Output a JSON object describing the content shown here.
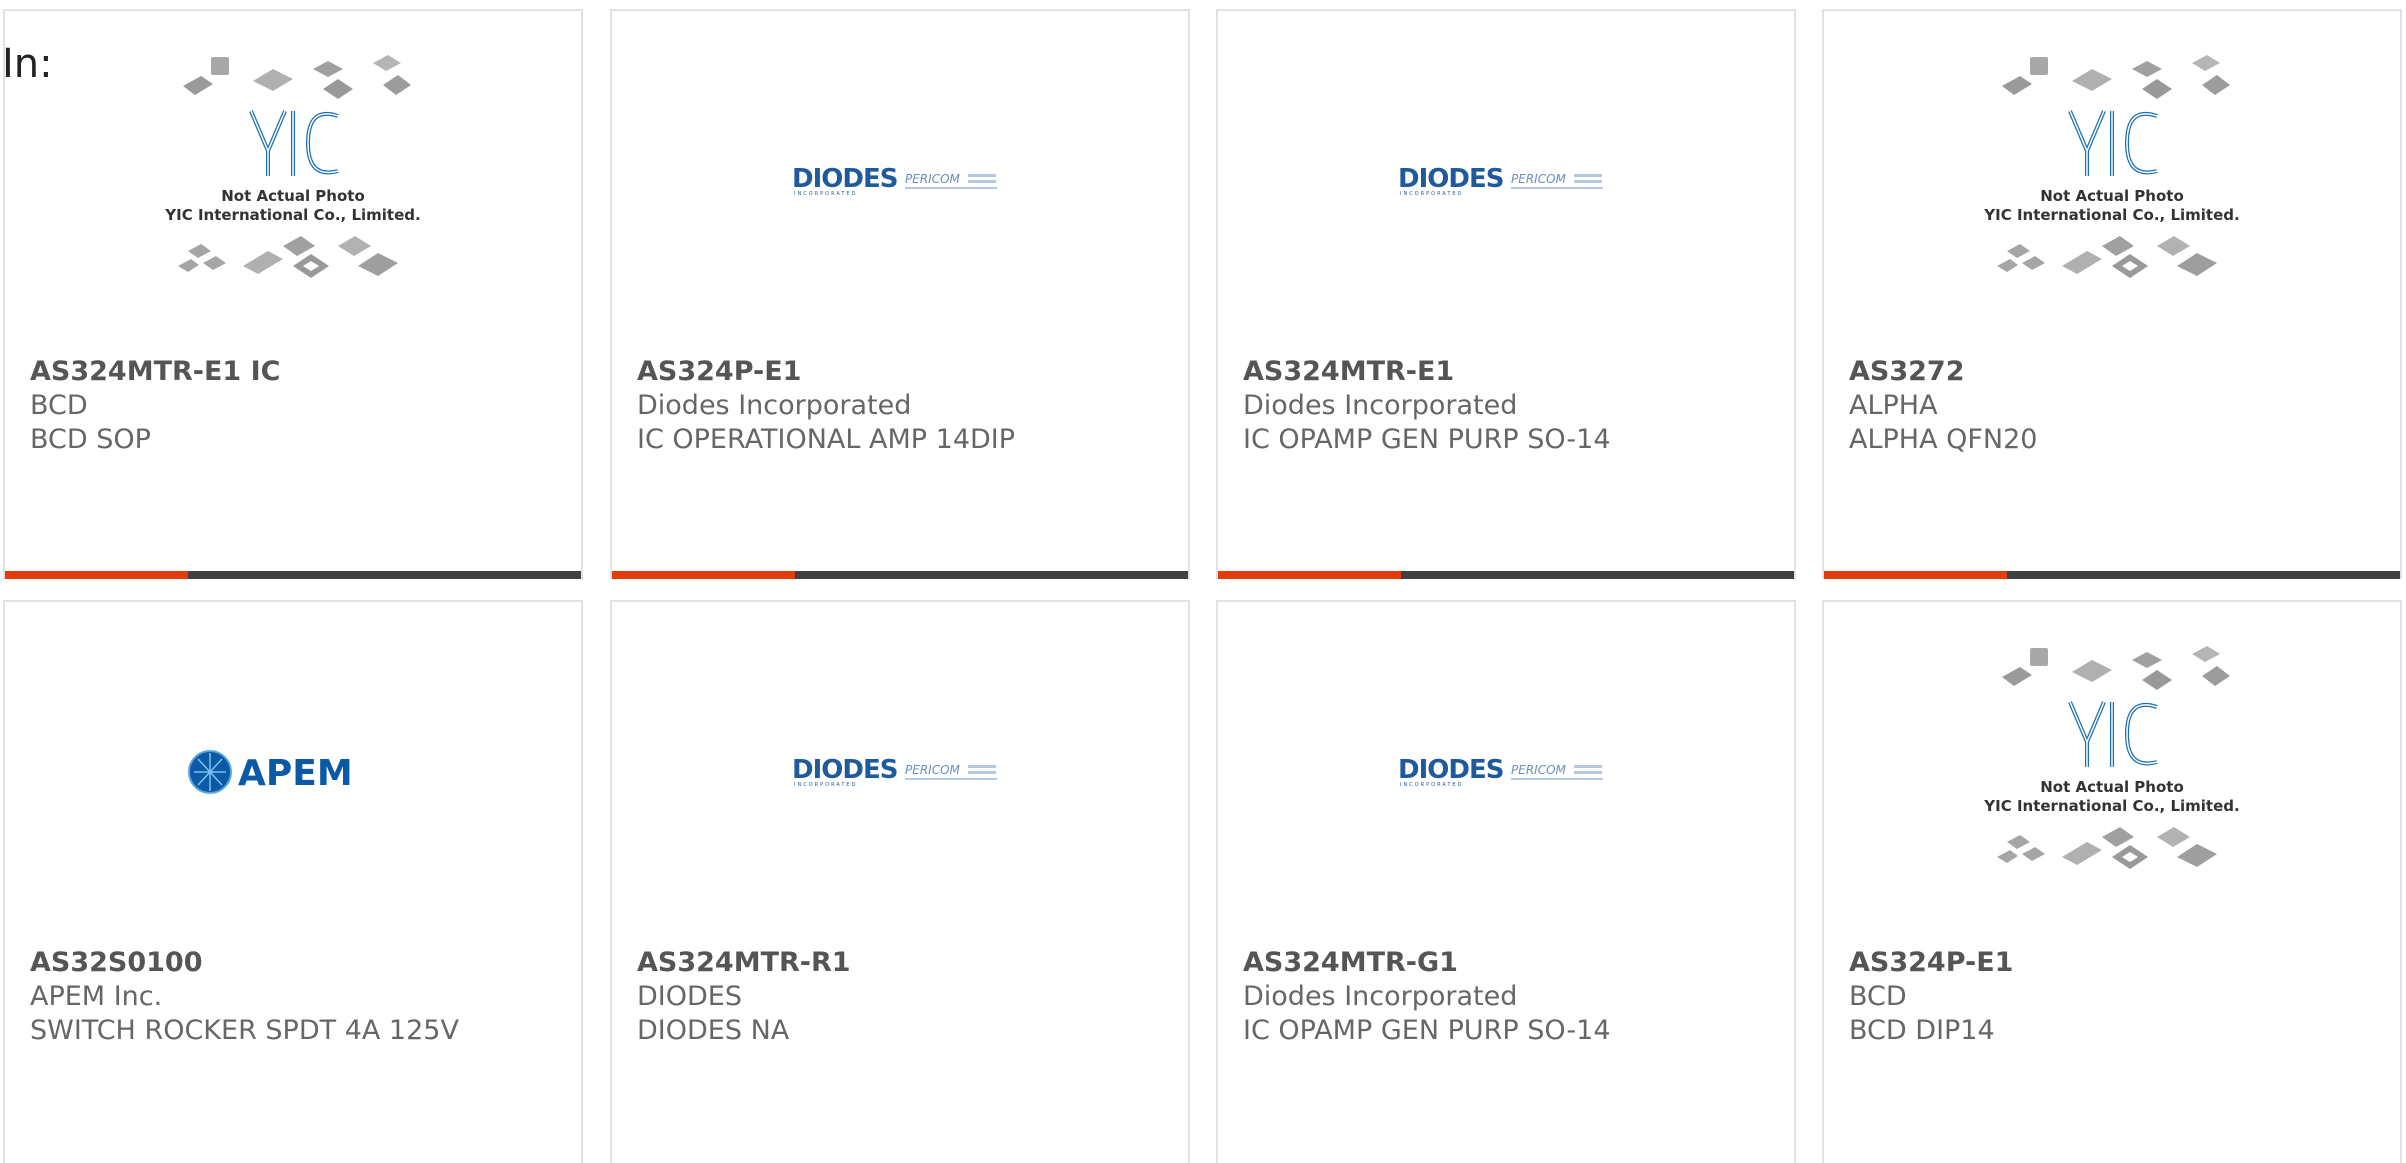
{
  "header": {
    "in_label": "In:"
  },
  "logos": {
    "yic_line1": "Not Actual Photo",
    "yic_line2": "YIC International Co., Limited.",
    "yic_mark": "YIC",
    "diodes_mark": "DIODES",
    "diodes_sub": "INCORPORATED",
    "pericom_mark": "PERICOM",
    "apem_mark": "APEM"
  },
  "cards": [
    {
      "part": "AS324MTR-E1 IC",
      "manufacturer": "BCD",
      "description": "BCD SOP",
      "image": "yic-placeholder"
    },
    {
      "part": "AS324P-E1",
      "manufacturer": "Diodes Incorporated",
      "description": "IC OPERATIONAL AMP 14DIP",
      "image": "diodes-logo"
    },
    {
      "part": "AS324MTR-E1",
      "manufacturer": "Diodes Incorporated",
      "description": "IC OPAMP GEN PURP SO-14",
      "image": "diodes-logo"
    },
    {
      "part": "AS3272",
      "manufacturer": "ALPHA",
      "description": "ALPHA QFN20",
      "image": "yic-placeholder"
    },
    {
      "part": "AS32S0100",
      "manufacturer": "APEM Inc.",
      "description": "SWITCH ROCKER SPDT 4A 125V",
      "image": "apem-logo"
    },
    {
      "part": "AS324MTR-R1",
      "manufacturer": "DIODES",
      "description": "DIODES NA",
      "image": "diodes-logo"
    },
    {
      "part": "AS324MTR-G1",
      "manufacturer": "Diodes Incorporated",
      "description": "IC OPAMP GEN PURP SO-14",
      "image": "diodes-logo"
    },
    {
      "part": "AS324P-E1",
      "manufacturer": "BCD",
      "description": "BCD DIP14",
      "image": "yic-placeholder"
    }
  ],
  "colors": {
    "accent": "#e03c0e",
    "bar": "#404040",
    "diodes_blue": "#1f5a9c",
    "apem_blue": "#0b5aa8",
    "yic_blue": "#1a6fb5"
  }
}
